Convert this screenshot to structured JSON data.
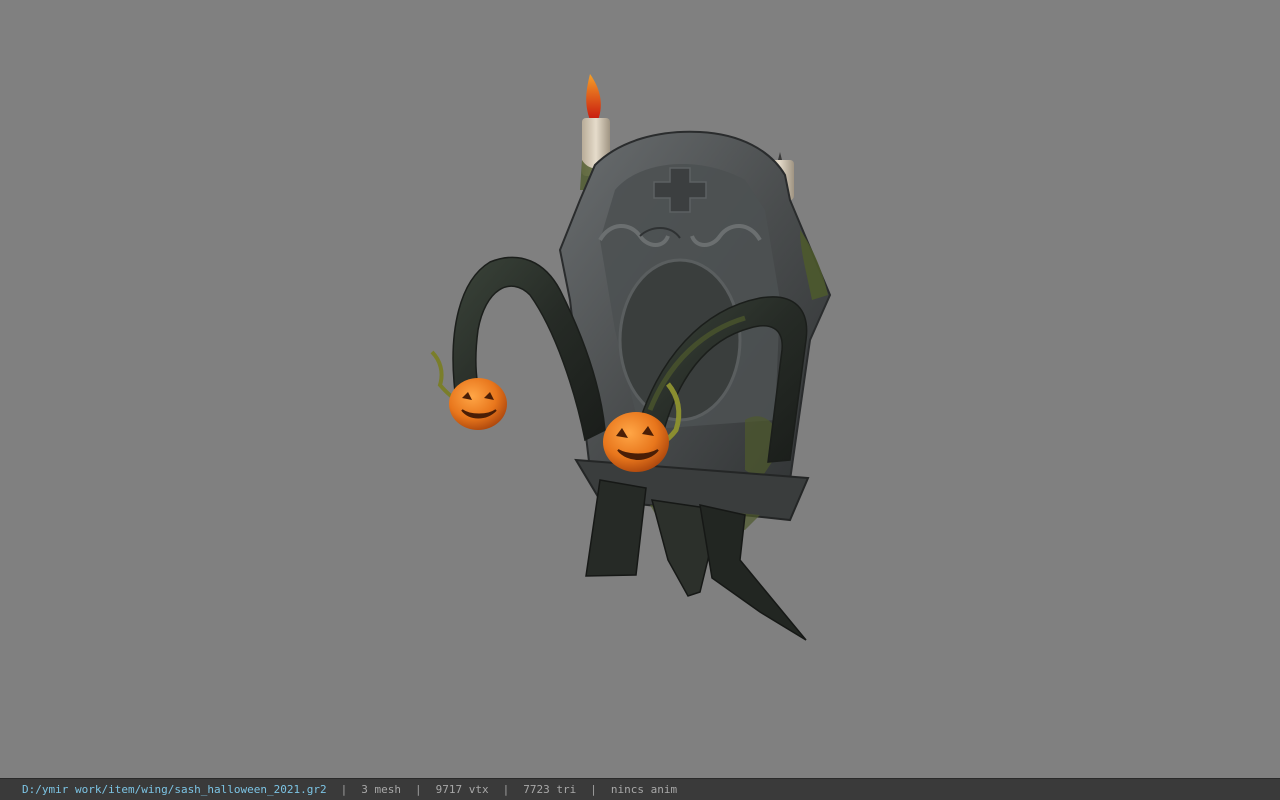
{
  "status_bar": {
    "file_path": "D:/ymir work/item/wing/sash_halloween_2021.gr2",
    "separator": "|",
    "mesh_count": "3 mesh",
    "vertex_count": "9717 vtx",
    "triangle_count": "7723 tri",
    "anim_status": "nincs anim"
  },
  "colors": {
    "viewport_background": "#808080",
    "status_bar_background": "#3a3a3a",
    "path_text": "#7cc4e4",
    "stat_text": "#a8a8a8",
    "pumpkin": "#e8761c",
    "stone": "#4a4d4e",
    "moss": "#4e5a2c",
    "candle_flame": "#d62a12"
  },
  "icons": {
    "model": "halloween-tombstone-sash-model",
    "pumpkin": "jack-o-lantern-icon",
    "candle": "candle-icon"
  }
}
